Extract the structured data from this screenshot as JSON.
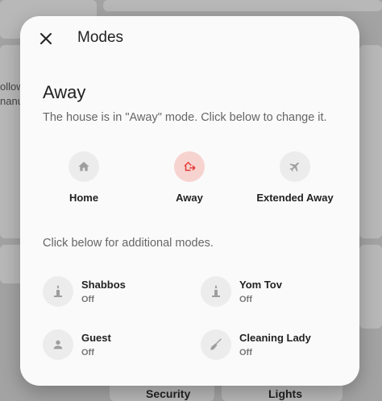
{
  "background": {
    "side_text_1": "ollow",
    "side_text_2": "nanu",
    "bottom_labels": [
      "Security",
      "Lights"
    ]
  },
  "dialog": {
    "title": "Modes",
    "current_mode": "Away",
    "description": "The house is in \"Away\" mode. Click below to change it.",
    "primary_modes": [
      {
        "label": "Home",
        "icon": "home-icon",
        "active": false
      },
      {
        "label": "Away",
        "icon": "away-icon",
        "active": true
      },
      {
        "label": "Extended Away",
        "icon": "airplane-icon",
        "active": false
      }
    ],
    "additional_prompt": "Click below for additional modes.",
    "additional_modes": [
      {
        "name": "Shabbos",
        "state": "Off",
        "icon": "candle-icon"
      },
      {
        "name": "Yom Tov",
        "state": "Off",
        "icon": "candle-icon"
      },
      {
        "name": "Guest",
        "state": "Off",
        "icon": "person-icon"
      },
      {
        "name": "Cleaning Lady",
        "state": "Off",
        "icon": "broom-icon"
      }
    ]
  },
  "colors": {
    "accent": "#e53935",
    "active_bg": "#f7d3d0",
    "icon_grey": "#9e9e9e"
  }
}
